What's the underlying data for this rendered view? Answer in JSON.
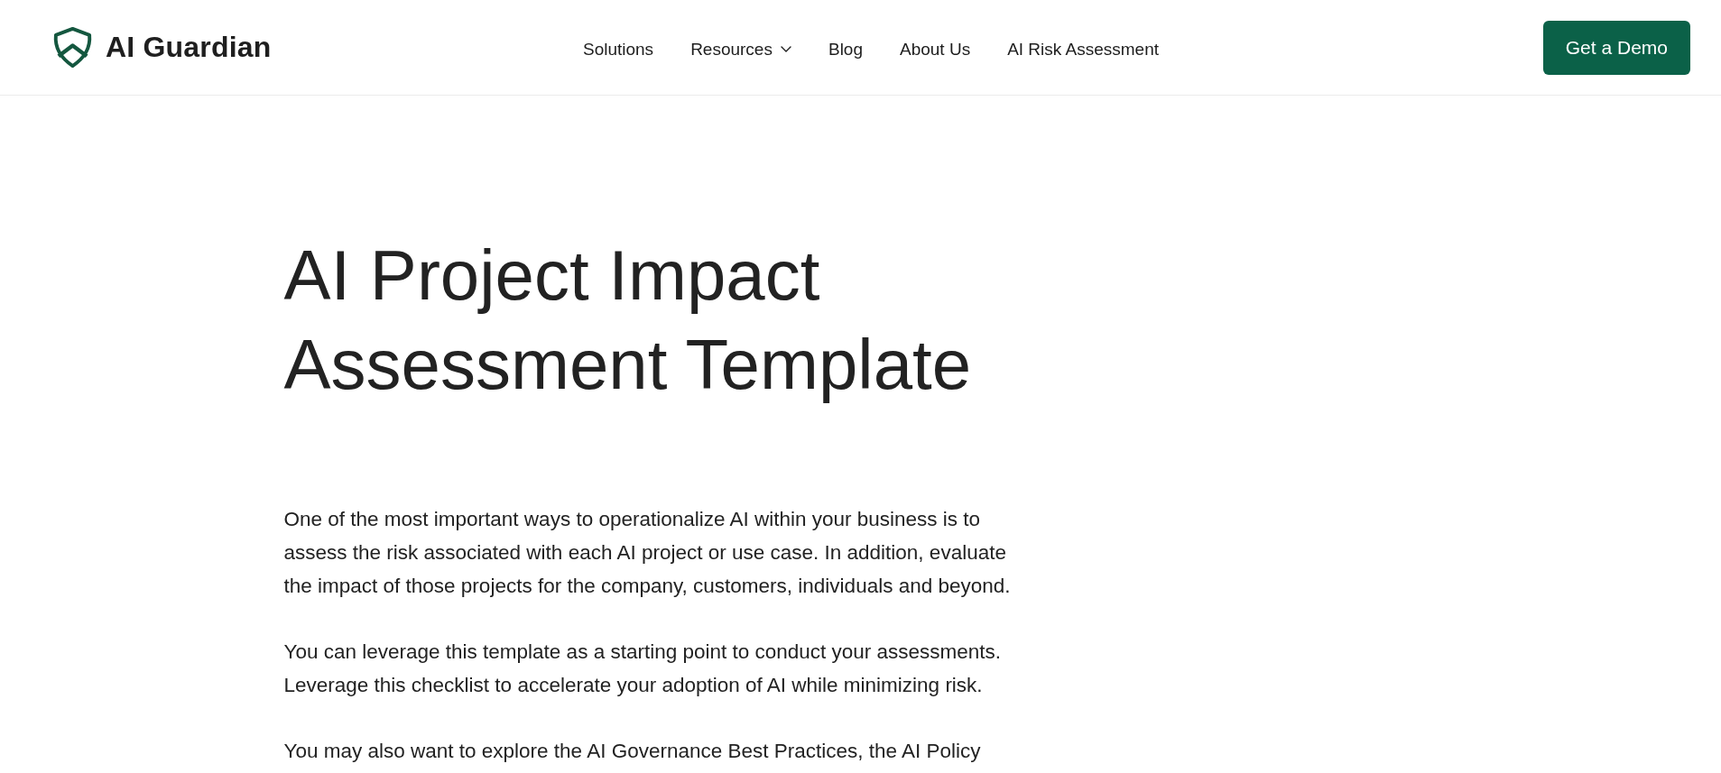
{
  "header": {
    "logo": {
      "text": "AI Guardian"
    },
    "nav": [
      {
        "label": "Solutions",
        "has_dropdown": false
      },
      {
        "label": "Resources",
        "has_dropdown": true
      },
      {
        "label": "Blog",
        "has_dropdown": false
      },
      {
        "label": "About Us",
        "has_dropdown": false
      },
      {
        "label": "AI Risk Assessment",
        "has_dropdown": false
      }
    ],
    "cta_button": "Get a Demo"
  },
  "article": {
    "title": "AI Project Impact Assessment Template",
    "paragraphs": [
      {
        "lines": [
          "One of the most important ways to operationalize AI within your business is to",
          "assess the risk associated with each AI project or use case. In addition, evaluate",
          "the impact of those projects for the company, customers, individuals and beyond."
        ]
      },
      {
        "lines": [
          "You can leverage this template as a starting point to conduct your assessments.",
          "Leverage this checklist to accelerate your adoption of AI while minimizing risk."
        ]
      },
      {
        "lines": [
          "You may also want to explore the AI Governance Best Practices, the AI Policy"
        ]
      }
    ]
  }
}
